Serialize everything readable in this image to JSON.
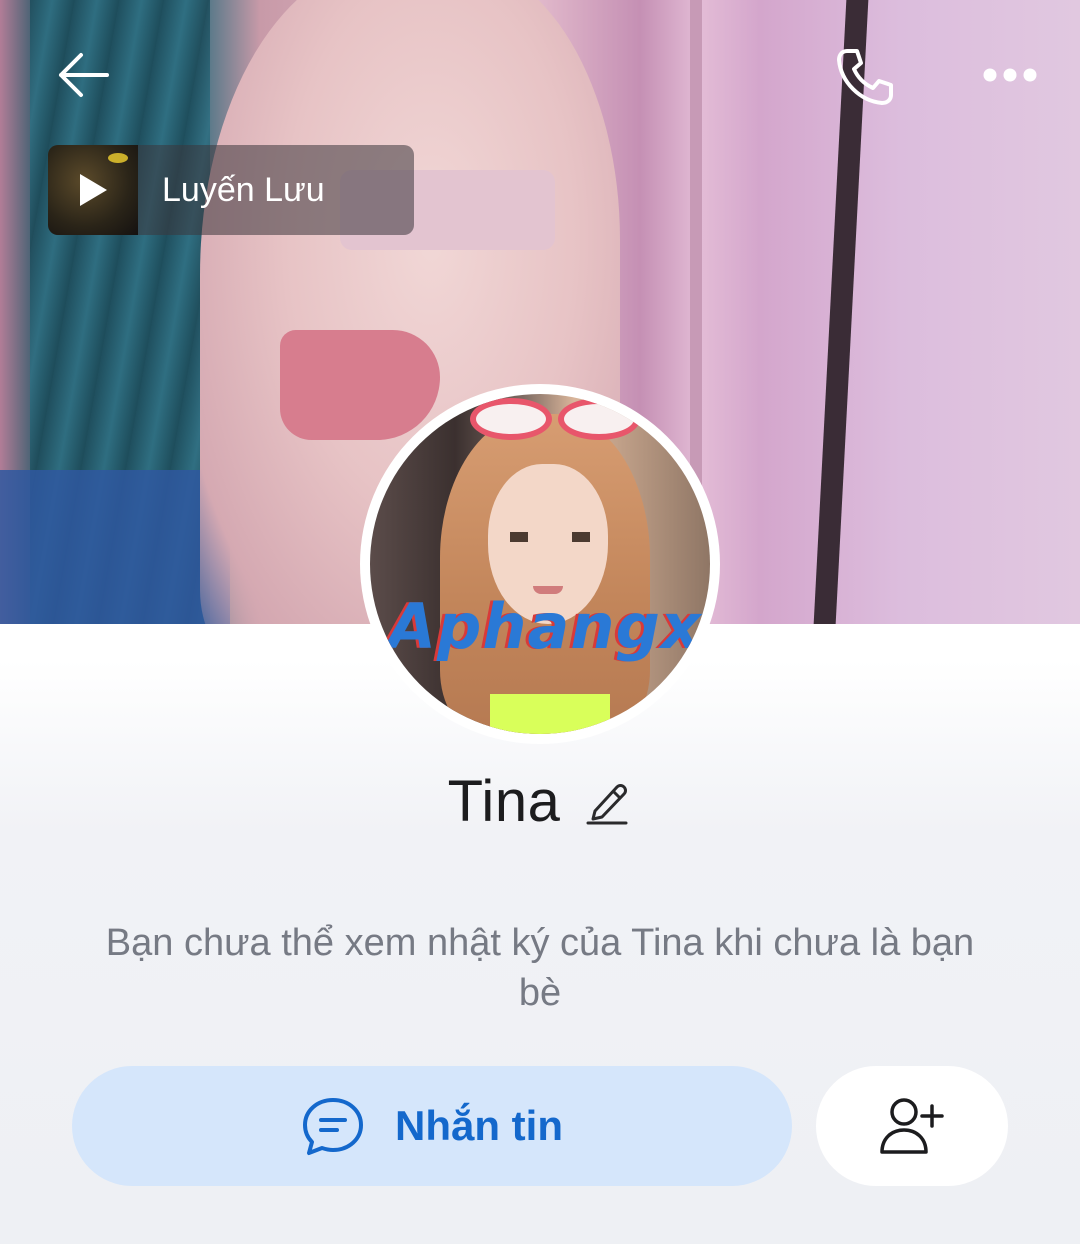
{
  "header": {
    "back_icon": "arrow-left-icon",
    "call_icon": "phone-icon",
    "more_icon": "more-horizontal-icon"
  },
  "music": {
    "title": "Luyến Lưu",
    "icon": "play-icon"
  },
  "avatar": {
    "watermark": "Aphangx"
  },
  "profile": {
    "name": "Tina",
    "edit_icon": "pencil-icon"
  },
  "notice": "Bạn chưa thể xem nhật ký của Tina khi chưa là bạn bè",
  "actions": {
    "message_label": "Nhắn tin",
    "message_icon": "chat-bubble-icon",
    "add_friend_icon": "add-user-icon"
  },
  "colors": {
    "accent": "#1468cc",
    "message_button_bg": "#d5e6fb",
    "text_primary": "#1c1c1e",
    "text_secondary": "#767a84"
  }
}
